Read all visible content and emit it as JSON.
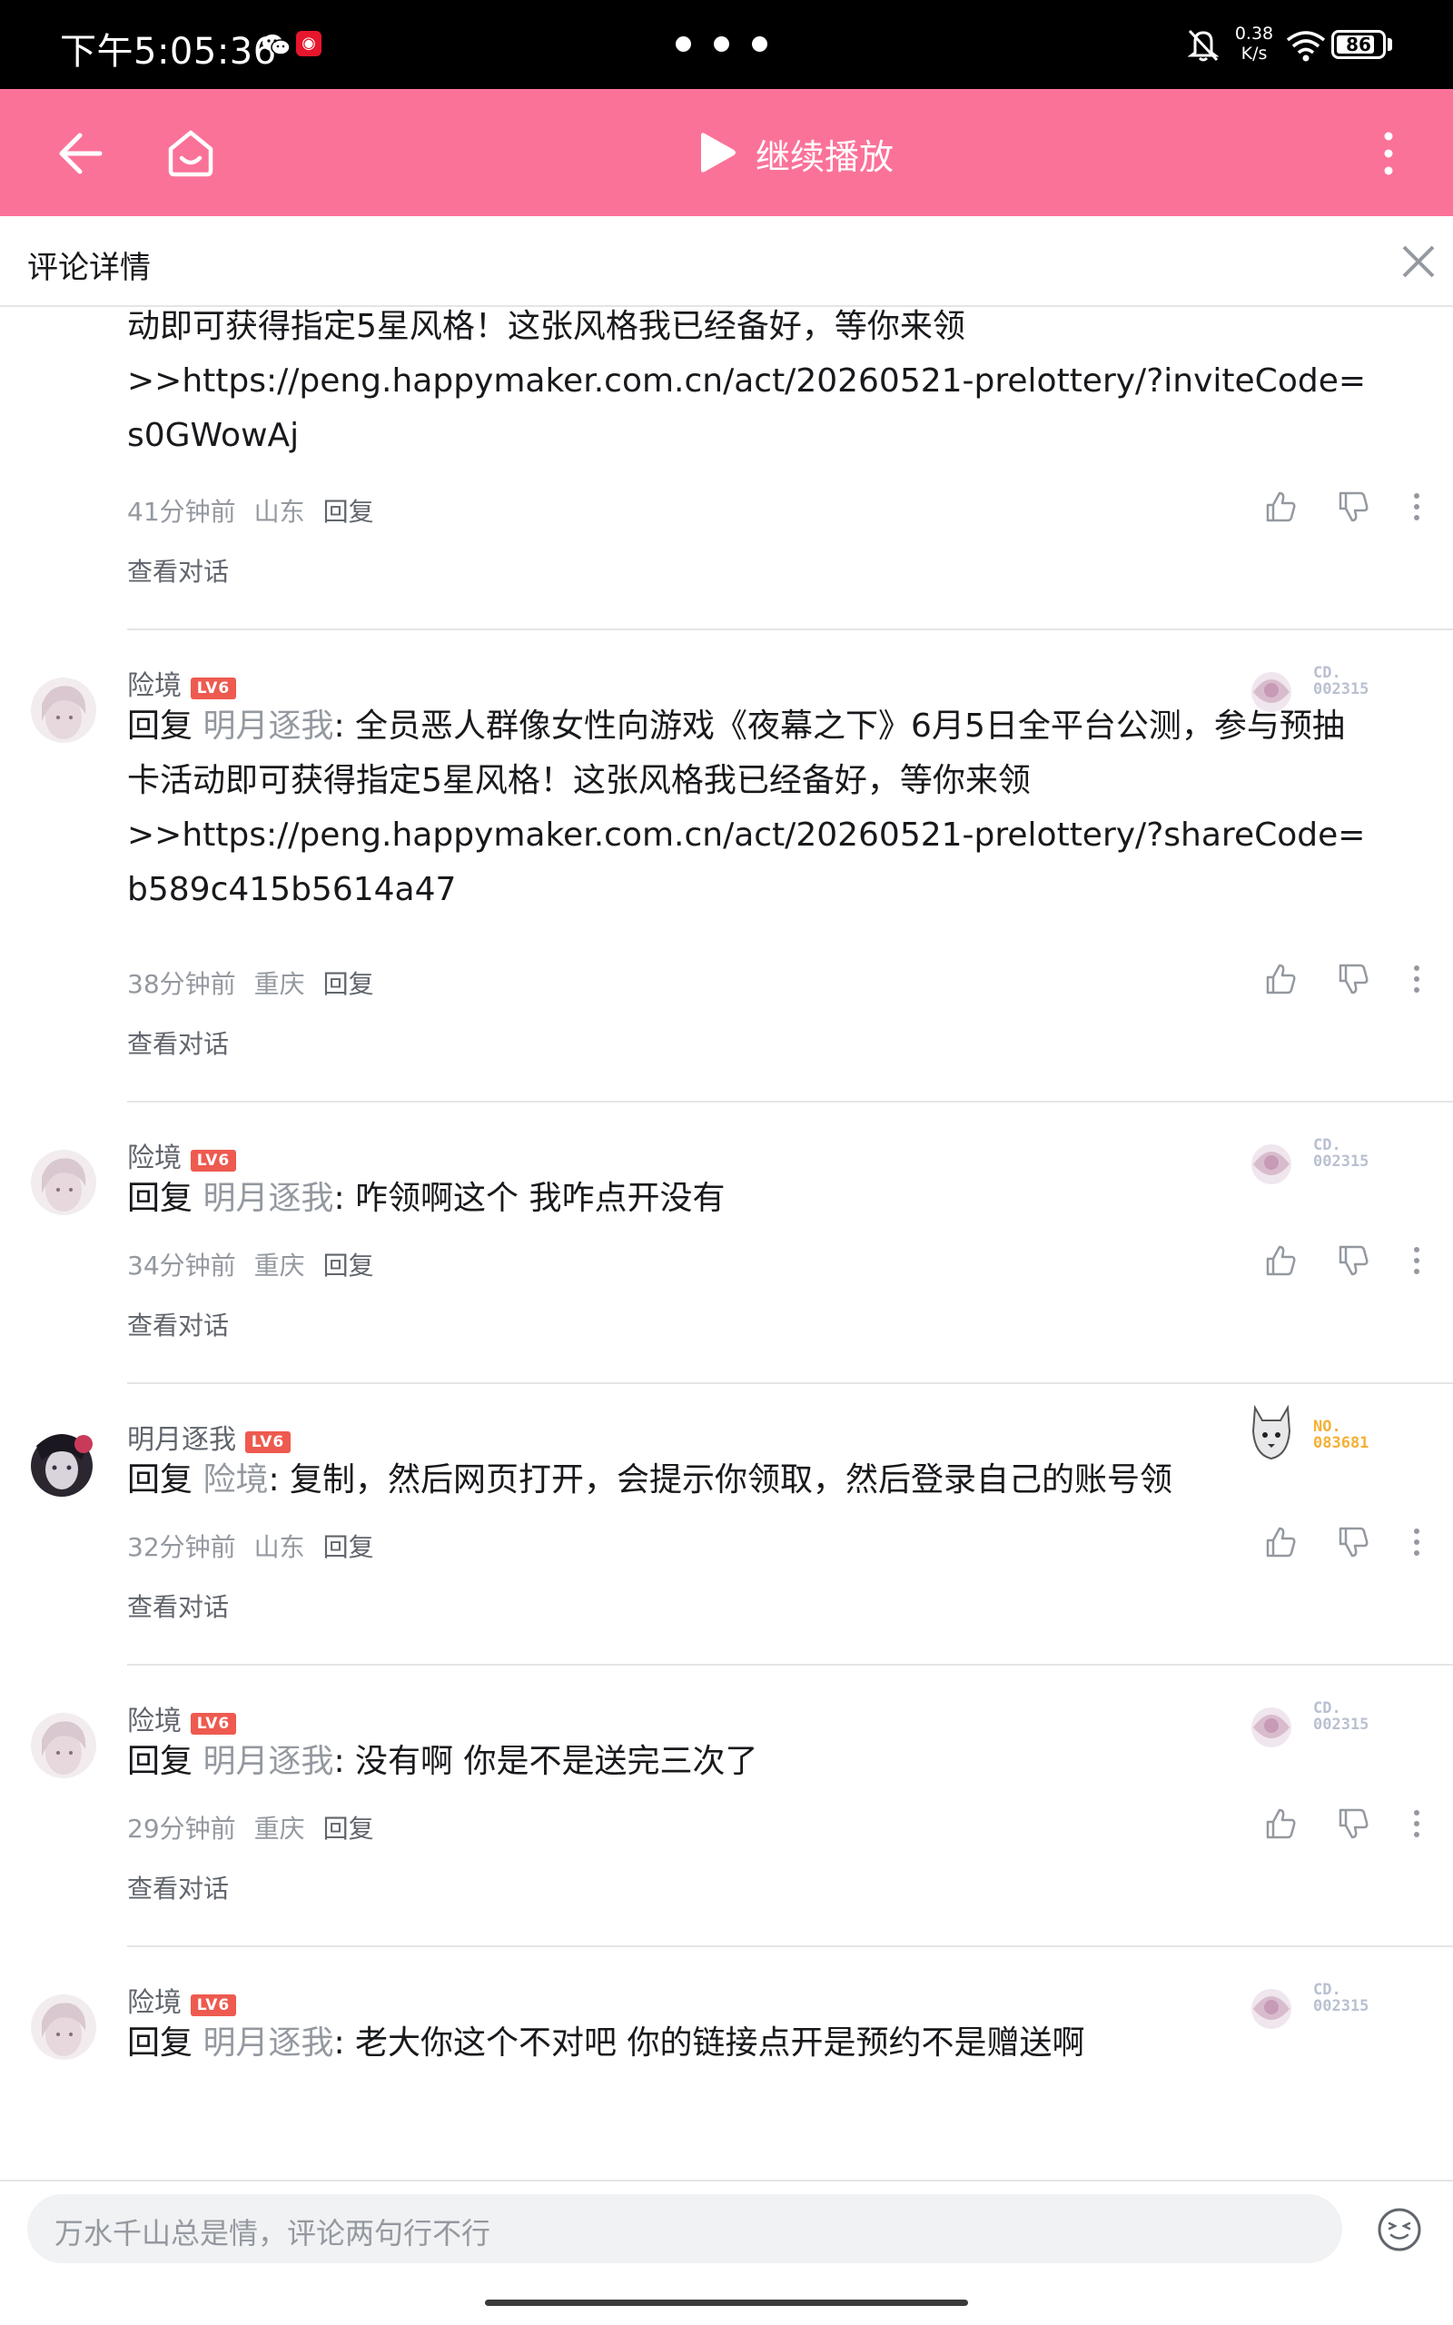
{
  "status_bar": {
    "time": "下午5:05:36",
    "speed_value": "0.38",
    "speed_unit": "K/s",
    "battery": "86"
  },
  "app_bar": {
    "continue_label": "继续播放",
    "colors": {
      "brand": "#fb7299"
    }
  },
  "detail": {
    "title": "评论详情"
  },
  "first_comment": {
    "lines": [
      "动即可获得指定5星风格！这张风格我已经备好，等你来领",
      ">>https://peng.happymaker.com.cn/act/20260521-prelottery/?inviteCode=",
      "s0GWowAj"
    ],
    "time": "41分钟前",
    "location": "山东",
    "reply_label": "回复",
    "view_conversation": "查看对话"
  },
  "comments": [
    {
      "user": "险境",
      "level": "LV6",
      "fan_no_prefix": "CD.",
      "fan_no": "002315",
      "reply_prefix": "回复",
      "reply_to": "明月逐我",
      "lines": [
        ": 全员恶人群像女性向游戏《夜幕之下》6月5日全平台公测，参与预抽",
        "卡活动即可获得指定5星风格！这张风格我已经备好，等你来领",
        ">>https://peng.happymaker.com.cn/act/20260521-prelottery/?shareCode=",
        "b589c415b5614a47"
      ],
      "time": "38分钟前",
      "location": "重庆",
      "reply_label": "回复",
      "view_conversation": "查看对话"
    },
    {
      "user": "险境",
      "level": "LV6",
      "fan_no_prefix": "CD.",
      "fan_no": "002315",
      "reply_prefix": "回复",
      "reply_to": "明月逐我",
      "lines": [
        ": 咋领啊这个 我咋点开没有"
      ],
      "time": "34分钟前",
      "location": "重庆",
      "reply_label": "回复",
      "view_conversation": "查看对话"
    },
    {
      "user": "明月逐我",
      "level": "LV6",
      "fan_no_prefix": "NO.",
      "fan_no": "083681",
      "reply_prefix": "回复",
      "reply_to": "险境",
      "lines": [
        ": 复制，然后网页打开，会提示你领取，然后登录自己的账号领"
      ],
      "time": "32分钟前",
      "location": "山东",
      "reply_label": "回复",
      "view_conversation": "查看对话"
    },
    {
      "user": "险境",
      "level": "LV6",
      "fan_no_prefix": "CD.",
      "fan_no": "002315",
      "reply_prefix": "回复",
      "reply_to": "明月逐我",
      "lines": [
        ": 没有啊 你是不是送完三次了"
      ],
      "time": "29分钟前",
      "location": "重庆",
      "reply_label": "回复",
      "view_conversation": "查看对话"
    },
    {
      "user": "险境",
      "level": "LV6",
      "fan_no_prefix": "CD.",
      "fan_no": "002315",
      "reply_prefix": "回复",
      "reply_to": "明月逐我",
      "lines": [
        ": 老大你这个不对吧 你的链接点开是预约不是赠送啊"
      ]
    }
  ],
  "input": {
    "placeholder": "万水千山总是情，评论两句行不行"
  }
}
